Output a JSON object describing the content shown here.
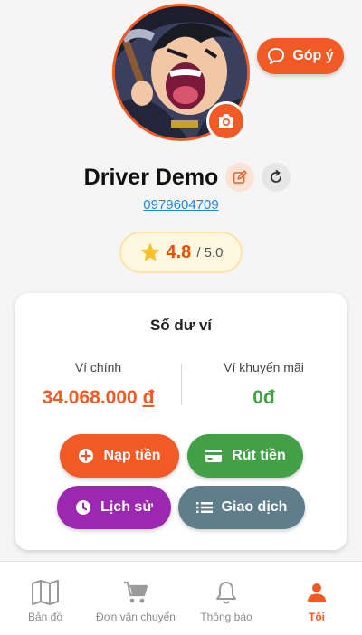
{
  "header": {
    "feedback_label": "Góp ý"
  },
  "profile": {
    "name": "Driver Demo",
    "phone": "0979604709"
  },
  "rating": {
    "value": "4.8",
    "max": "/ 5.0"
  },
  "wallet": {
    "title": "Số dư ví",
    "main_label": "Ví chính",
    "main_amount": "34.068.000",
    "main_currency": "đ",
    "promo_label": "Ví khuyến mãi",
    "promo_amount": "0đ",
    "actions": {
      "topup": "Nạp tiền",
      "withdraw": "Rút tiền",
      "history": "Lịch sử",
      "transactions": "Giao dịch"
    }
  },
  "nav": {
    "items": [
      {
        "label": "Bản đồ",
        "icon": "map-icon"
      },
      {
        "label": "Đơn vận chuyển",
        "icon": "cart-icon"
      },
      {
        "label": "Thông báo",
        "icon": "bell-icon"
      },
      {
        "label": "Tôi",
        "icon": "person-icon",
        "active": true
      }
    ]
  },
  "colors": {
    "accent": "#f15a24",
    "green": "#43a047",
    "purple": "#9c27b0",
    "slate": "#607d8b",
    "link": "#1e88e5"
  }
}
